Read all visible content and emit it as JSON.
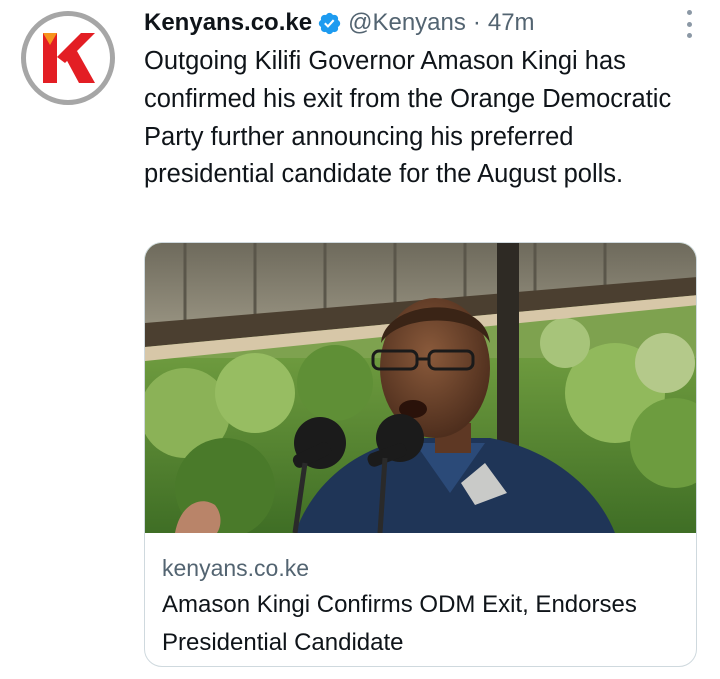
{
  "tweet": {
    "author": {
      "display_name": "Kenyans.co.ke",
      "verified": true,
      "handle": "@Kenyans",
      "separator": "·",
      "time_ago": "47m",
      "avatar_icon": "kenyans-k-logo-icon"
    },
    "text": "Outgoing Kilifi Governor Amason Kingi has confirmed his exit from the Orange Democratic Party further announcing his preferred presidential candidate for the August polls.",
    "more_icon": "more-options-icon",
    "card": {
      "domain": "kenyans.co.ke",
      "title": "Amason Kingi Confirms ODM Exit, Endorses Presidential Candidate",
      "image_description_icon": "article-photo"
    }
  },
  "colors": {
    "primary_text": "#0f1419",
    "secondary_text": "#536471",
    "verified_blue": "#1d9bf0",
    "brand_red": "#e31e24",
    "brand_orange": "#f7941d",
    "card_border": "#cfd9de"
  }
}
